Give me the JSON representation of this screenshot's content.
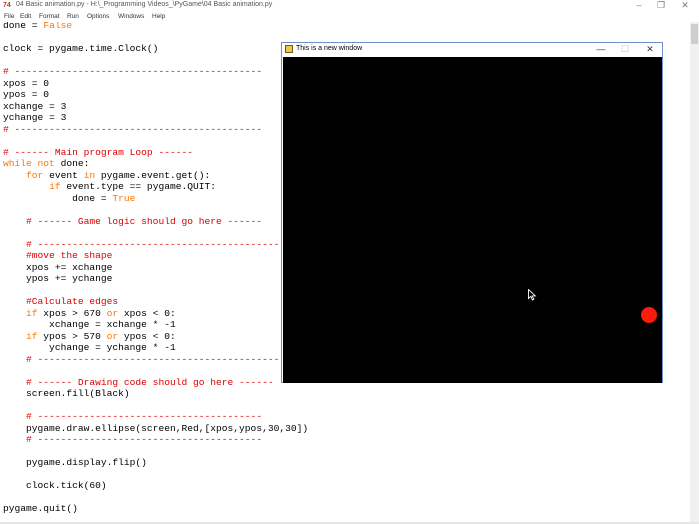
{
  "window": {
    "app_icon_text": "74",
    "title": "04 Basic animation.py - H:\\_Programming Videos_\\PyGame\\04 Basic animation.py",
    "minimize": "–",
    "maximize": "❐",
    "close": "✕"
  },
  "menu": [
    "File",
    "Edit",
    "Format",
    "Run",
    "Options",
    "Windows",
    "Help"
  ],
  "code_lines": [
    [
      {
        "t": "done = ",
        "c": "def"
      },
      {
        "t": "False",
        "c": "kw"
      }
    ],
    [],
    [
      {
        "t": "clock = pygame.time.Clock()",
        "c": "def"
      }
    ],
    [],
    [
      {
        "t": "# -------------------------------------------",
        "c": "com"
      }
    ],
    [
      {
        "t": "xpos = 0",
        "c": "def"
      }
    ],
    [
      {
        "t": "ypos = 0",
        "c": "def"
      }
    ],
    [
      {
        "t": "xchange = 3",
        "c": "def"
      }
    ],
    [
      {
        "t": "ychange = 3",
        "c": "def"
      }
    ],
    [
      {
        "t": "# -------------------------------------------",
        "c": "com"
      }
    ],
    [],
    [
      {
        "t": "# ------ Main program Loop ------",
        "c": "com"
      }
    ],
    [
      {
        "t": "while not",
        "c": "kw"
      },
      {
        "t": " done:",
        "c": "def"
      }
    ],
    [
      {
        "t": "    ",
        "c": "def"
      },
      {
        "t": "for",
        "c": "kw"
      },
      {
        "t": " event ",
        "c": "def"
      },
      {
        "t": "in",
        "c": "kw"
      },
      {
        "t": " pygame.event.get():",
        "c": "def"
      }
    ],
    [
      {
        "t": "        ",
        "c": "def"
      },
      {
        "t": "if",
        "c": "kw"
      },
      {
        "t": " event.type == pygame.QUIT:",
        "c": "def"
      }
    ],
    [
      {
        "t": "            done = ",
        "c": "def"
      },
      {
        "t": "True",
        "c": "kw"
      }
    ],
    [],
    [
      {
        "t": "    # ------ Game logic should go here ------",
        "c": "com"
      }
    ],
    [],
    [
      {
        "t": "    # -------------------------------------------",
        "c": "com"
      }
    ],
    [
      {
        "t": "    #move the shape",
        "c": "com"
      }
    ],
    [
      {
        "t": "    xpos += xchange",
        "c": "def"
      }
    ],
    [
      {
        "t": "    ypos += ychange",
        "c": "def"
      }
    ],
    [],
    [
      {
        "t": "    #Calculate edges",
        "c": "com"
      }
    ],
    [
      {
        "t": "    ",
        "c": "def"
      },
      {
        "t": "if",
        "c": "kw"
      },
      {
        "t": " xpos > 670 ",
        "c": "def"
      },
      {
        "t": "or",
        "c": "kw"
      },
      {
        "t": " xpos < 0:",
        "c": "def"
      }
    ],
    [
      {
        "t": "        xchange = xchange * -1",
        "c": "def"
      }
    ],
    [
      {
        "t": "    ",
        "c": "def"
      },
      {
        "t": "if",
        "c": "kw"
      },
      {
        "t": " ypos > 570 ",
        "c": "def"
      },
      {
        "t": "or",
        "c": "kw"
      },
      {
        "t": " ypos < 0:",
        "c": "def"
      }
    ],
    [
      {
        "t": "        ychange = ychange * -1",
        "c": "def"
      }
    ],
    [
      {
        "t": "    # -------------------------------------------",
        "c": "com"
      }
    ],
    [],
    [
      {
        "t": "    # ------ Drawing code should go here ------",
        "c": "com"
      }
    ],
    [
      {
        "t": "    screen.fill(Black)",
        "c": "def"
      }
    ],
    [],
    [
      {
        "t": "    # ---------------------------------------",
        "c": "com"
      }
    ],
    [
      {
        "t": "    pygame.draw.ellipse(screen,Red,[xpos,ypos,30,30])",
        "c": "def"
      }
    ],
    [
      {
        "t": "    # ---------------------------------------",
        "c": "com"
      }
    ],
    [],
    [
      {
        "t": "    pygame.display.flip()",
        "c": "def"
      }
    ],
    [],
    [
      {
        "t": "    clock.tick(60)",
        "c": "def"
      }
    ],
    [],
    [
      {
        "t": "pygame.quit()",
        "c": "def"
      }
    ]
  ],
  "pygame_window": {
    "title": "This is a new window",
    "minimize": "—",
    "maximize": "☐",
    "close": "✕",
    "background": "#000000",
    "ball_color": "#ff1a0e"
  },
  "colors": {
    "comment": "#dd0000",
    "keyword": "#ff7700",
    "default": "#000000"
  }
}
